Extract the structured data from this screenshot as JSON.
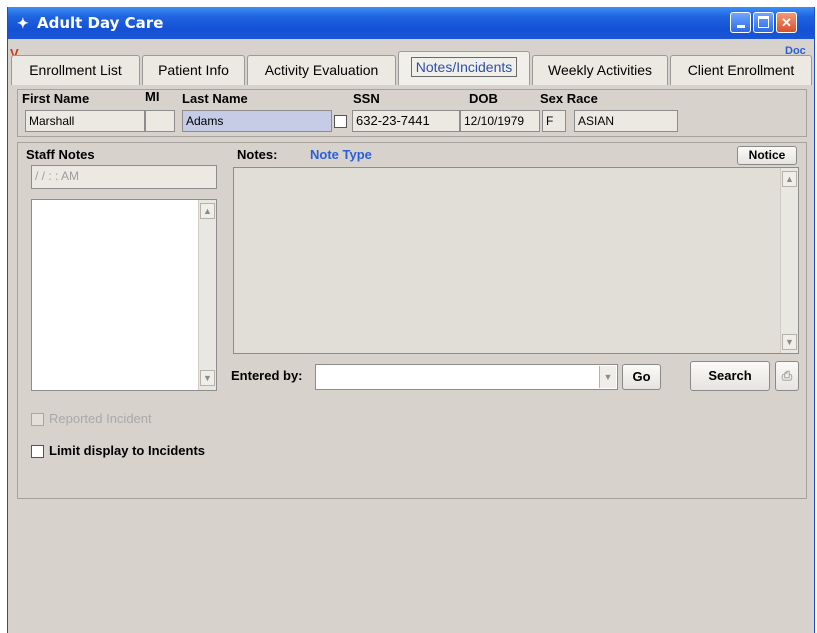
{
  "window": {
    "title": "Adult Day Care",
    "app_icon": "person-icon",
    "controls": [
      "minimize-icon",
      "maximize-icon",
      "close-icon"
    ]
  },
  "tab_corner": {
    "left_mark": "V",
    "right_mark": "Doc"
  },
  "tabs": [
    {
      "label": "Enrollment List",
      "active": false
    },
    {
      "label": "Patient Info",
      "active": false
    },
    {
      "label": "Activity Evaluation",
      "active": false
    },
    {
      "label": "Notes/Incidents",
      "active": true
    },
    {
      "label": "Weekly Activities",
      "active": false
    },
    {
      "label": "Client Enrollment",
      "active": false
    }
  ],
  "patient": {
    "first_name_label": "First Name",
    "first_name": "Marshall",
    "mi_label": "MI",
    "mi": "",
    "last_name_label": "Last Name",
    "last_name": "Adams",
    "ssn_label": "SSN",
    "ssn": "632-23-7441",
    "dob_label": "DOB",
    "dob": "12/10/1979",
    "sex_race_label": "Sex Race",
    "sex": "F",
    "race": "ASIAN"
  },
  "staff_notes": {
    "label": "Staff Notes",
    "datetime_placeholder": "/ /      : :   AM"
  },
  "notes": {
    "label": "Notes:",
    "note_type_label": "Note Type",
    "notice_button": "Notice",
    "text": ""
  },
  "entered_by": {
    "label": "Entered by:",
    "value": "",
    "go_button": "Go",
    "search_button": "Search"
  },
  "options": {
    "reported_incident": "Reported Incident",
    "limit_display": "Limit display to Incidents"
  },
  "colors": {
    "title_bar": "#1f5fe0",
    "window_bg": "#d7d3cc",
    "highlight_field": "#c6cbe6",
    "note_type_text": "#2b5fd8"
  }
}
